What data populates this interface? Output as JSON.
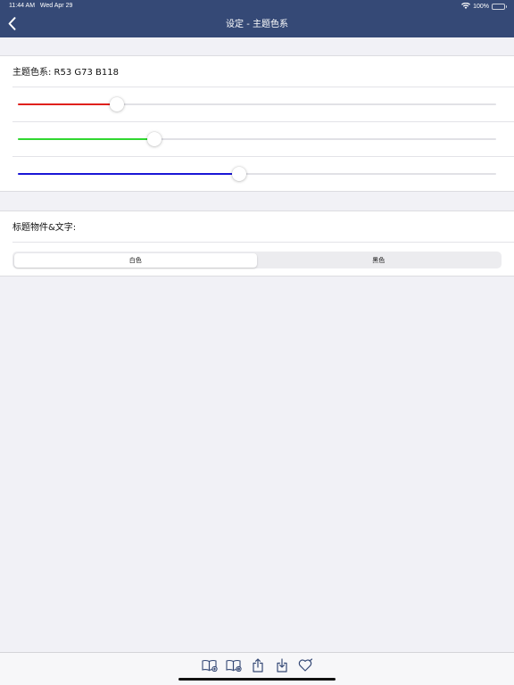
{
  "status_bar": {
    "time": "11:44 AM",
    "date": "Wed Apr 29",
    "battery": "100%"
  },
  "nav": {
    "title": "设定 - 主题色系",
    "background_color": "#354976"
  },
  "theme_color": {
    "label": "主题色系: R53 G73 B118",
    "sliders": [
      {
        "name": "red",
        "color": "#e0201c",
        "value": 53,
        "max": 255
      },
      {
        "name": "green",
        "color": "#30d730",
        "value": 73,
        "max": 255
      },
      {
        "name": "blue",
        "color": "#1a16d6",
        "value": 118,
        "max": 255
      }
    ]
  },
  "title_widget": {
    "label": "标题物件&文字:",
    "options": [
      "白色",
      "黑色"
    ],
    "selected": "白色"
  },
  "toolbar": {
    "icons": [
      "book-add-icon",
      "book-settings-icon",
      "share-upload-icon",
      "download-icon",
      "favorite-heart-icon"
    ]
  }
}
